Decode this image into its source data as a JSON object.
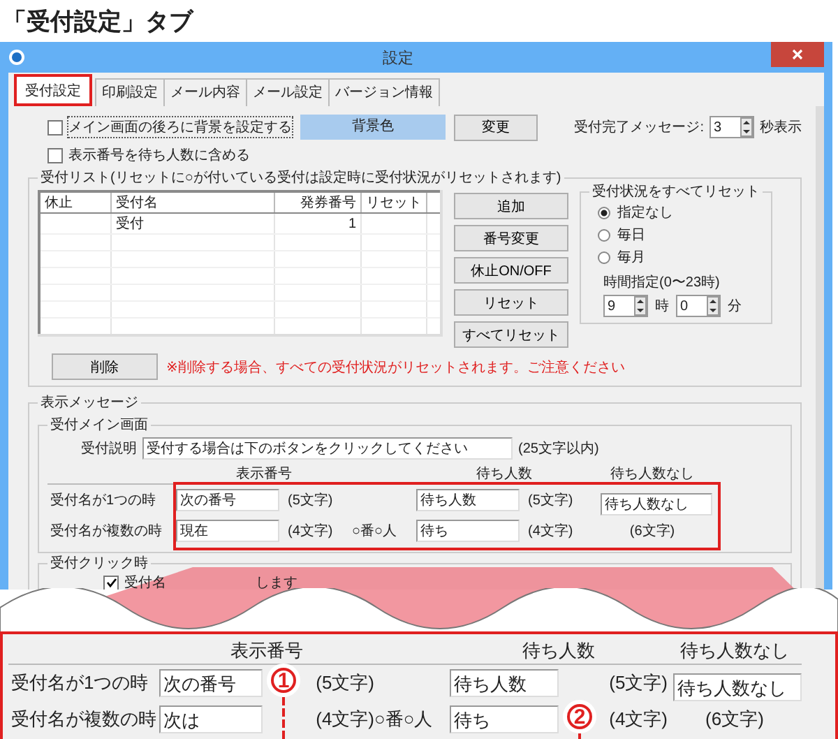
{
  "caption": "「受付設定」タブ",
  "window": {
    "title": "設定"
  },
  "tabs": [
    {
      "label": "受付設定",
      "selected": true
    },
    {
      "label": "印刷設定",
      "selected": false
    },
    {
      "label": "メール内容",
      "selected": false
    },
    {
      "label": "メール設定",
      "selected": false
    },
    {
      "label": "バージョン情報",
      "selected": false
    }
  ],
  "options": [
    {
      "label": "メイン画面の後ろに背景を設定する",
      "checked": false
    },
    {
      "label": "表示番号を待ち人数に含める",
      "checked": false
    }
  ],
  "background": {
    "swatch": "背景色",
    "button": "変更"
  },
  "completion_message": {
    "label": "受付完了メッセージ:",
    "value": "3",
    "unit": "秒表示"
  },
  "reception_list": {
    "title": "受付リスト(リセットに○が付いている受付は設定時に受付状況がリセットされます)",
    "columns": [
      "休止",
      "受付名",
      "発券番号",
      "リセット"
    ],
    "rows": [
      {
        "name": "受付",
        "number": "1"
      }
    ],
    "buttons": [
      "追加",
      "番号変更",
      "休止ON/OFF",
      "リセット",
      "すべてリセット"
    ],
    "delete_button": "削除",
    "warning": "※削除する場合、すべての受付状況がリセットされます。ご注意ください"
  },
  "reset_all": {
    "title": "受付状況をすべてリセット",
    "options": [
      {
        "label": "指定なし",
        "selected": true
      },
      {
        "label": "毎日",
        "selected": false
      },
      {
        "label": "毎月",
        "selected": false
      }
    ],
    "time_label": "時間指定(0〜23時)",
    "hour": {
      "value": "9",
      "unit": "時"
    },
    "minute": {
      "value": "0",
      "unit": "分"
    }
  },
  "display_message": {
    "title": "表示メッセージ",
    "main_screen": {
      "title": "受付メイン画面",
      "description": {
        "label": "受付説明",
        "value": "受付する場合は下のボタンをクリックしてください",
        "note": "(25文字以内)"
      },
      "headers": [
        "表示番号",
        "待ち人数",
        "待ち人数なし"
      ],
      "rows": [
        {
          "label": "受付名が1つの時",
          "number": "次の番号",
          "number_note": "(5文字)",
          "waiting": "待ち人数",
          "waiting_note": "(5文字)"
        },
        {
          "label": "受付名が複数の時",
          "number": "現在",
          "number_note": "(4文字)",
          "separator": "○番○人",
          "waiting": "待ち",
          "waiting_note": "(4文字)"
        }
      ],
      "no_waiting": {
        "value": "待ち人数なし",
        "note": "(6文字)"
      }
    },
    "click": {
      "title": "受付クリック時",
      "checked": true,
      "text_1": "受付名",
      "text_2": "します"
    }
  },
  "zoom": {
    "headers": [
      "表示番号",
      "待ち人数",
      "待ち人数なし"
    ],
    "rows": [
      {
        "label": "受付名が1つの時",
        "number": "次の番号",
        "number_note": "(5文字)",
        "waiting": "待ち人数",
        "waiting_note": "(5文字)"
      },
      {
        "label": "受付名が複数の時",
        "number": "次は",
        "number_note": "(4文字)",
        "separator": "○番○人",
        "waiting": "待ち",
        "waiting_note": "(4文字)"
      }
    ],
    "no_waiting": {
      "value": "待ち人数なし",
      "note": "(6文字)"
    },
    "callouts": [
      "1",
      "2"
    ]
  }
}
